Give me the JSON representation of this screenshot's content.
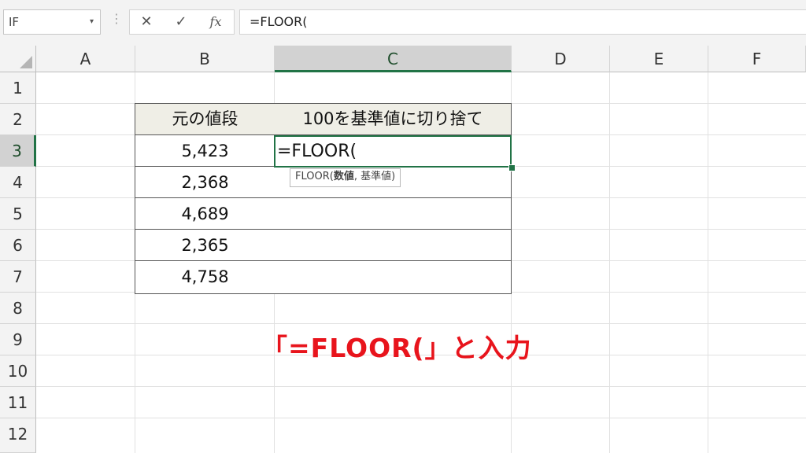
{
  "formula_bar": {
    "name_box": "IF",
    "name_box_arrow": "▾",
    "vertical_dots": "⋮",
    "cancel_symbol": "✕",
    "enter_symbol": "✓",
    "fx_label": "fx",
    "formula": "=FLOOR("
  },
  "columns": [
    "A",
    "B",
    "C",
    "D",
    "E",
    "F"
  ],
  "rows": [
    "1",
    "2",
    "3",
    "4",
    "5",
    "6",
    "7",
    "8",
    "9",
    "10",
    "11",
    "12"
  ],
  "table": {
    "header_b": "元の値段",
    "header_c": "100を基準値に切り捨て",
    "values": [
      "5,423",
      "2,368",
      "4,689",
      "2,365",
      "4,758"
    ]
  },
  "active_cell": {
    "text": "=FLOOR(",
    "tooltip_func": "FLOOR(",
    "tooltip_arg1": "数値",
    "tooltip_rest": ", 基準値)"
  },
  "annotation": "「=FLOOR(」と入力",
  "colors": {
    "accent_green": "#217346",
    "annotation_red": "#e8141c",
    "header_fill": "#efeee6"
  }
}
